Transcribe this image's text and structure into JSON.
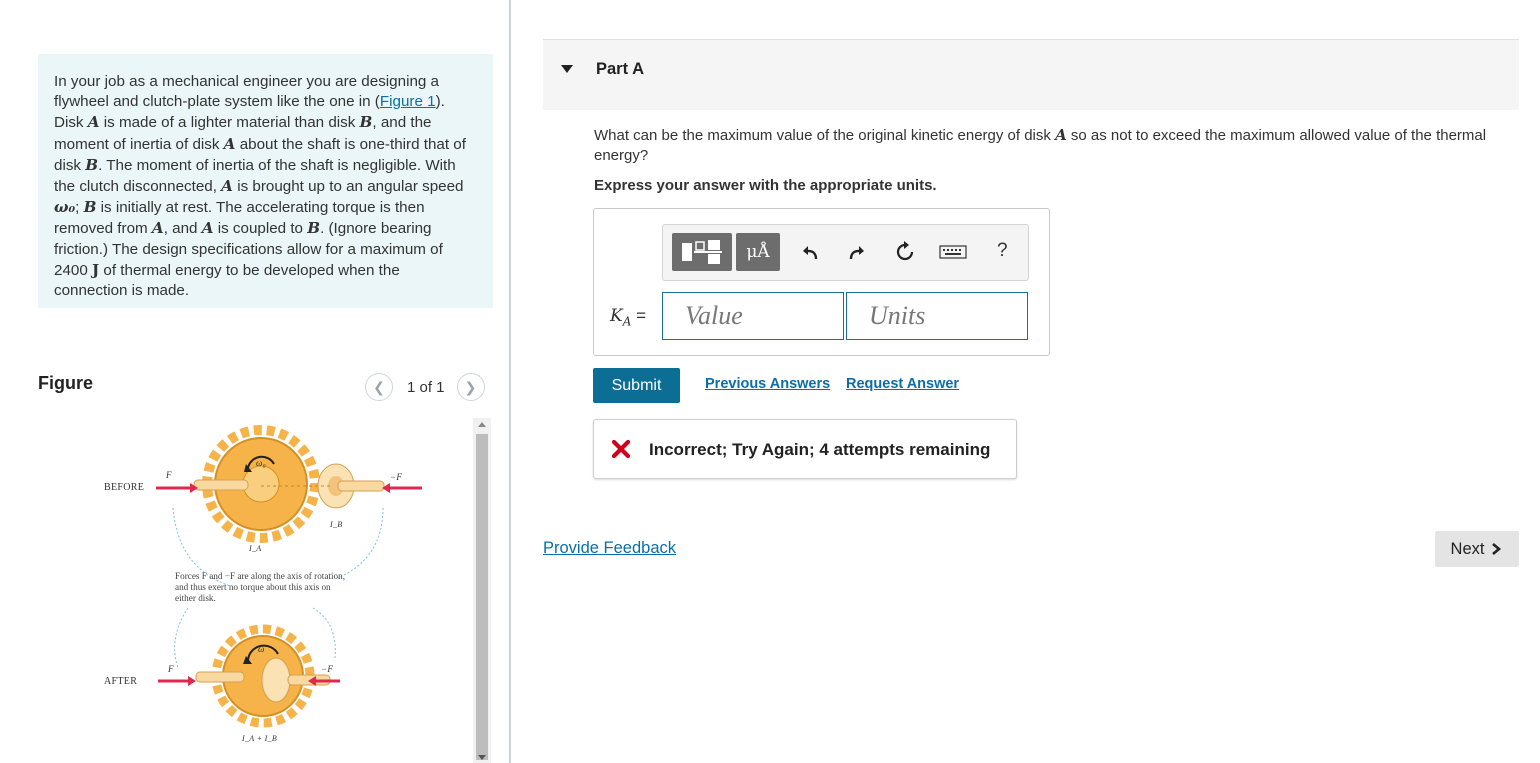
{
  "problem": {
    "t1": "In your job as a mechanical engineer you are designing a flywheel and clutch-plate system like the one in (",
    "figure_link": "Figure 1",
    "t2": "). Disk ",
    "var_a": "A",
    "t3": " is made of a lighter material than disk ",
    "var_b": "B",
    "t4": ", and the moment of inertia of disk ",
    "t5": " about the shaft is one-third that of disk ",
    "t6": ". The moment of inertia of the shaft is negligible. With the clutch disconnected, ",
    "t7": " is brought up to an angular speed ",
    "omega0": "ω₀",
    "t8": "; ",
    "t9": " is initially at rest. The accelerating torque is then removed from ",
    "t10": ", and ",
    "t11": " is coupled to ",
    "t12": ". (Ignore bearing friction.) The design specifications allow for a maximum of 2400 ",
    "unit_j": "J",
    "t13": " of thermal energy to be developed when the connection is made."
  },
  "figure": {
    "title": "Figure",
    "count": "1 of 1",
    "labels": {
      "before": "BEFORE",
      "after": "AFTER",
      "f": "F",
      "neg_f": "−F",
      "omega0": "ω₀",
      "omega": "ω",
      "ia": "I_A",
      "ib": "I_B",
      "iab": "I_A + I_B",
      "note1": "Forces F and −F are along the axis of rotation,",
      "note2": "and thus exert no torque about this axis on",
      "note3": "either disk."
    }
  },
  "part": {
    "title": "Part A",
    "question_1": "What can be the maximum value of the original kinetic energy of disk ",
    "question_var": "A",
    "question_2": " so as not to exceed the maximum allowed value of the thermal energy?",
    "instruction": "Express your answer with the appropriate units."
  },
  "answer": {
    "label_var": "K",
    "label_sub": "A",
    "label_eq": " =",
    "value_placeholder": "Value",
    "units_placeholder": "Units",
    "unit_button": "μÅ",
    "help": "?"
  },
  "actions": {
    "submit": "Submit",
    "previous": "Previous Answers",
    "request": "Request Answer"
  },
  "feedback": {
    "text": "Incorrect; Try Again; 4 attempts remaining"
  },
  "footer": {
    "provide_feedback": "Provide Feedback",
    "next": "Next"
  },
  "colors": {
    "accent": "#0c6e94",
    "link": "#0a6fa8",
    "error": "#d0021b",
    "problem_bg": "#eaf6f7"
  }
}
